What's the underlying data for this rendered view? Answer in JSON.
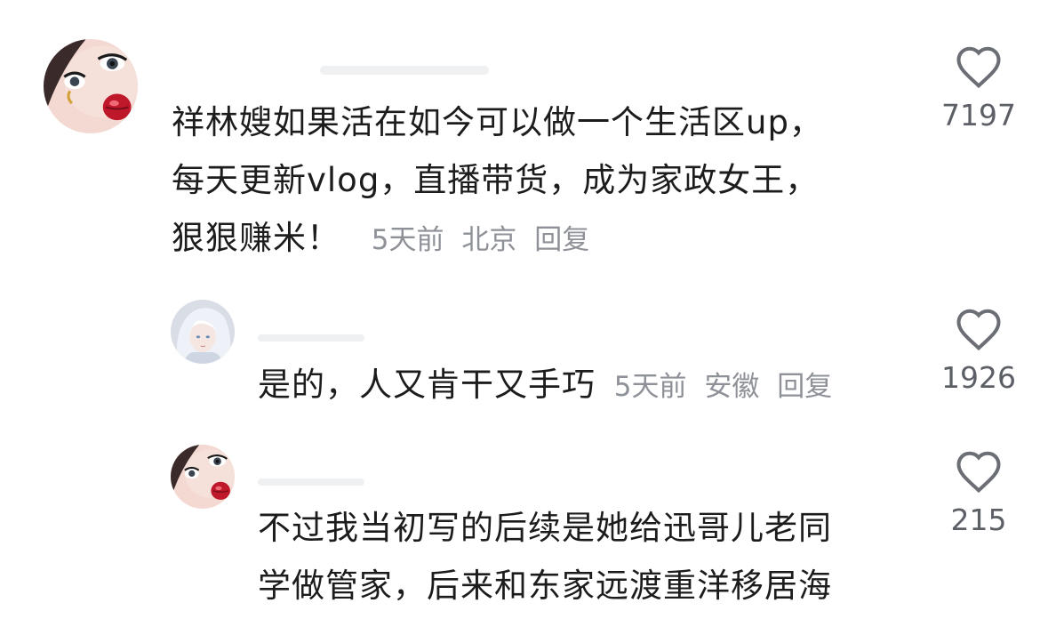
{
  "comments": [
    {
      "text_lines": [
        "祥林嫂如果活在如今可以做一个生活区up，",
        "每天更新vlog，直播带货，成为家政女王，",
        "狠狠赚米！"
      ],
      "time": "5天前",
      "location": "北京",
      "reply_label": "回复",
      "likes": "7197",
      "avatar_icon": "doll-avatar"
    },
    {
      "text_lines": [
        "是的，人又肯干又手巧"
      ],
      "time": "5天前",
      "location": "安徽",
      "reply_label": "回复",
      "likes": "1926",
      "avatar_icon": "silver-hair-avatar"
    },
    {
      "text_lines": [
        "不过我当初写的后续是她给迅哥儿老同",
        "学做管家，后来和东家远渡重洋移居海"
      ],
      "likes": "215",
      "avatar_icon": "doll-avatar"
    }
  ],
  "colors": {
    "text": "#1c1c1c",
    "meta": "#8e9198",
    "count": "#5c5f66"
  }
}
